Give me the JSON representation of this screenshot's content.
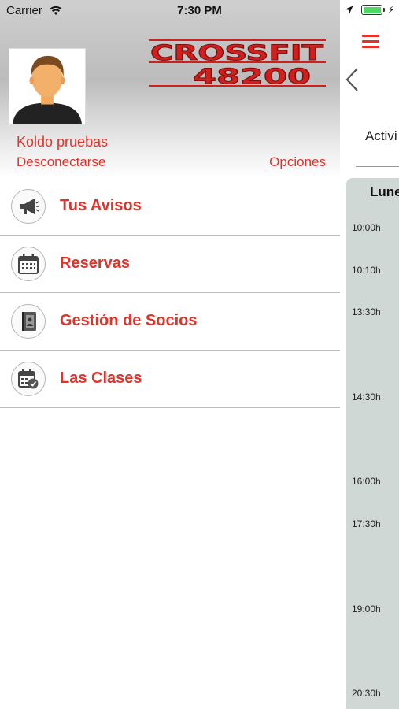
{
  "status_bar": {
    "carrier": "Carrier",
    "time": "7:30 PM"
  },
  "drawer": {
    "user_name": "Koldo pruebas",
    "logout_label": "Desconectarse",
    "options_label": "Opciones",
    "logo_text": {
      "line1": "CROSSFIT",
      "line2": "48200"
    },
    "menu": [
      {
        "label": "Tus Avisos",
        "icon": "megaphone-icon"
      },
      {
        "label": "Reservas",
        "icon": "calendar-icon"
      },
      {
        "label": "Gestión de Socios",
        "icon": "contact-book-icon"
      },
      {
        "label": "Las Clases",
        "icon": "calendar-check-icon"
      }
    ]
  },
  "content": {
    "activity_label": "Activi",
    "day_label": "Lune",
    "time_slots": [
      "10:00h",
      "10:10h",
      "13:30h",
      "14:30h",
      "16:00h",
      "17:30h",
      "19:00h",
      "20:30h"
    ]
  },
  "colors": {
    "accent": "#e1332a",
    "schedule_bg": "#cfd8d4",
    "battery": "#4cd964"
  }
}
